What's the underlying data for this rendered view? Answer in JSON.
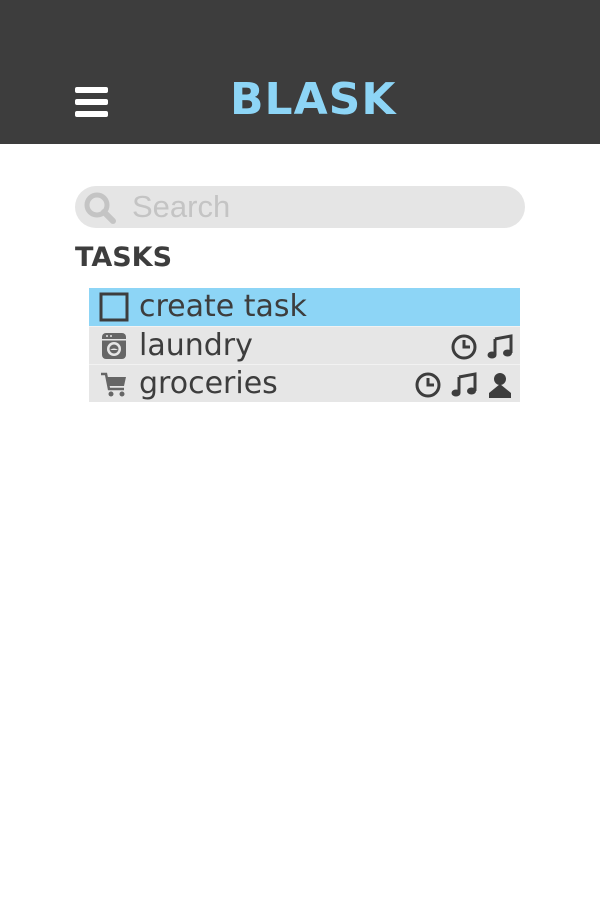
{
  "header": {
    "title": "BLASK",
    "title_color": "#8dd5f6",
    "background": "#3d3d3d",
    "menu_icon": "hamburger-menu-icon"
  },
  "search": {
    "placeholder": "Search",
    "value": "",
    "icon": "search-icon"
  },
  "tasks": {
    "heading": "TASKS",
    "items": [
      {
        "label": "create task",
        "icon": "checkbox-icon",
        "selected": true,
        "badges": []
      },
      {
        "label": "laundry",
        "icon": "washing-machine-icon",
        "selected": false,
        "badges": [
          "clock-icon",
          "music-note-icon"
        ]
      },
      {
        "label": "groceries",
        "icon": "shopping-cart-icon",
        "selected": false,
        "badges": [
          "clock-icon",
          "music-note-icon",
          "person-icon"
        ]
      }
    ],
    "highlight_color": "#8dd5f6",
    "row_color": "#e6e6e6"
  }
}
